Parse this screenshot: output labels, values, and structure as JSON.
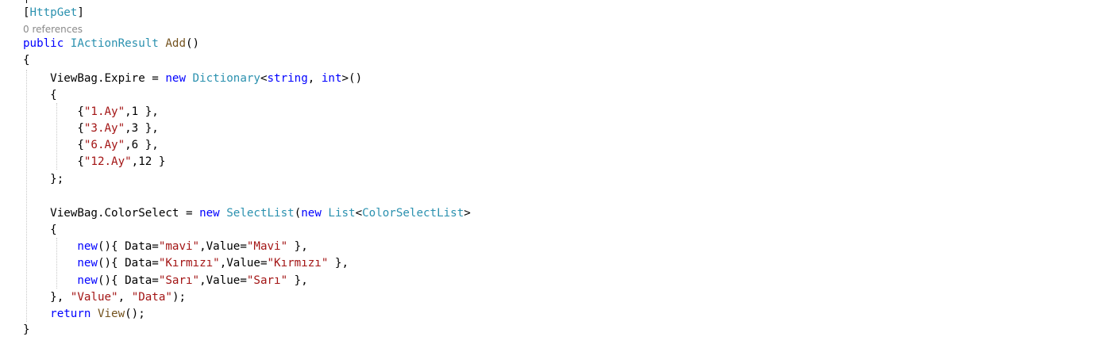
{
  "colors": {
    "keyword": "#0000ff",
    "type": "#2b91af",
    "method": "#74531f",
    "string": "#a31515",
    "plain": "#000000",
    "codelens": "#8a8a8a"
  },
  "codelens": "0 references",
  "lines": [
    [
      {
        "t": "[",
        "c": "pl"
      },
      {
        "t": "HttpGet",
        "c": "ty"
      },
      {
        "t": "]",
        "c": "pl"
      }
    ],
    [
      {
        "t": "public",
        "c": "kw"
      },
      {
        "t": " ",
        "c": "pl"
      },
      {
        "t": "IActionResult",
        "c": "ty"
      },
      {
        "t": " ",
        "c": "pl"
      },
      {
        "t": "Add",
        "c": "mt"
      },
      {
        "t": "()",
        "c": "pl"
      }
    ],
    [
      {
        "t": "{",
        "c": "pl"
      }
    ],
    [
      {
        "t": "    ViewBag.Expire = ",
        "c": "pl"
      },
      {
        "t": "new",
        "c": "kw"
      },
      {
        "t": " ",
        "c": "pl"
      },
      {
        "t": "Dictionary",
        "c": "ty"
      },
      {
        "t": "<",
        "c": "pl"
      },
      {
        "t": "string",
        "c": "kw"
      },
      {
        "t": ", ",
        "c": "pl"
      },
      {
        "t": "int",
        "c": "kw"
      },
      {
        "t": ">()",
        "c": "pl"
      }
    ],
    [
      {
        "t": "    {",
        "c": "pl"
      }
    ],
    [
      {
        "t": "        {",
        "c": "pl"
      },
      {
        "t": "\"1.Ay\"",
        "c": "st"
      },
      {
        "t": ",1 },",
        "c": "pl"
      }
    ],
    [
      {
        "t": "        {",
        "c": "pl"
      },
      {
        "t": "\"3.Ay\"",
        "c": "st"
      },
      {
        "t": ",3 },",
        "c": "pl"
      }
    ],
    [
      {
        "t": "        {",
        "c": "pl"
      },
      {
        "t": "\"6.Ay\"",
        "c": "st"
      },
      {
        "t": ",6 },",
        "c": "pl"
      }
    ],
    [
      {
        "t": "        {",
        "c": "pl"
      },
      {
        "t": "\"12.Ay\"",
        "c": "st"
      },
      {
        "t": ",12 }",
        "c": "pl"
      }
    ],
    [
      {
        "t": "    };",
        "c": "pl"
      }
    ],
    [],
    [
      {
        "t": "    ViewBag.ColorSelect = ",
        "c": "pl"
      },
      {
        "t": "new",
        "c": "kw"
      },
      {
        "t": " ",
        "c": "pl"
      },
      {
        "t": "SelectList",
        "c": "ty"
      },
      {
        "t": "(",
        "c": "pl"
      },
      {
        "t": "new",
        "c": "kw"
      },
      {
        "t": " ",
        "c": "pl"
      },
      {
        "t": "List",
        "c": "ty"
      },
      {
        "t": "<",
        "c": "pl"
      },
      {
        "t": "ColorSelectList",
        "c": "ty"
      },
      {
        "t": ">",
        "c": "pl"
      }
    ],
    [
      {
        "t": "    {",
        "c": "pl"
      }
    ],
    [
      {
        "t": "        ",
        "c": "pl"
      },
      {
        "t": "new",
        "c": "kw"
      },
      {
        "t": "(){ Data=",
        "c": "pl"
      },
      {
        "t": "\"mavi\"",
        "c": "st"
      },
      {
        "t": ",Value=",
        "c": "pl"
      },
      {
        "t": "\"Mavi\"",
        "c": "st"
      },
      {
        "t": " },",
        "c": "pl"
      }
    ],
    [
      {
        "t": "        ",
        "c": "pl"
      },
      {
        "t": "new",
        "c": "kw"
      },
      {
        "t": "(){ Data=",
        "c": "pl"
      },
      {
        "t": "\"Kırmızı\"",
        "c": "st"
      },
      {
        "t": ",Value=",
        "c": "pl"
      },
      {
        "t": "\"Kırmızı\"",
        "c": "st"
      },
      {
        "t": " },",
        "c": "pl"
      }
    ],
    [
      {
        "t": "        ",
        "c": "pl"
      },
      {
        "t": "new",
        "c": "kw"
      },
      {
        "t": "(){ Data=",
        "c": "pl"
      },
      {
        "t": "\"Sarı\"",
        "c": "st"
      },
      {
        "t": ",Value=",
        "c": "pl"
      },
      {
        "t": "\"Sarı\"",
        "c": "st"
      },
      {
        "t": " },",
        "c": "pl"
      }
    ],
    [
      {
        "t": "    }, ",
        "c": "pl"
      },
      {
        "t": "\"Value\"",
        "c": "st"
      },
      {
        "t": ", ",
        "c": "pl"
      },
      {
        "t": "\"Data\"",
        "c": "st"
      },
      {
        "t": ");",
        "c": "pl"
      }
    ],
    [
      {
        "t": "    ",
        "c": "pl"
      },
      {
        "t": "return",
        "c": "kw"
      },
      {
        "t": " ",
        "c": "pl"
      },
      {
        "t": "View",
        "c": "mt"
      },
      {
        "t": "();",
        "c": "pl"
      }
    ],
    [
      {
        "t": "}",
        "c": "pl"
      }
    ]
  ]
}
